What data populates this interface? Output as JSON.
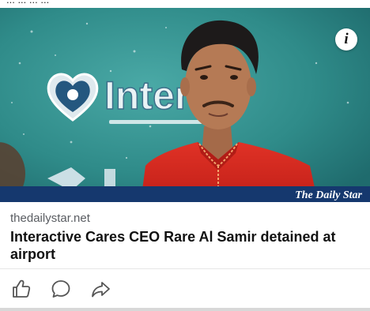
{
  "card": {
    "source": "thedailystar.net",
    "headline": "Interactive Cares CEO Rare Al Samir detained at airport",
    "watermark": "The Daily Star",
    "backdrop_text": "Intera",
    "top_text": "... ... ... ..."
  },
  "actions": [
    {
      "name": "like",
      "icon": "thumbs-up-icon"
    },
    {
      "name": "comment",
      "icon": "comment-bubble-icon"
    },
    {
      "name": "share",
      "icon": "share-arrow-icon"
    }
  ],
  "colors": {
    "backdrop": "#2f8d8b",
    "shirt": "#d7281f",
    "band": "#15386e",
    "text_primary": "#111111",
    "text_secondary": "#5a5d62"
  }
}
